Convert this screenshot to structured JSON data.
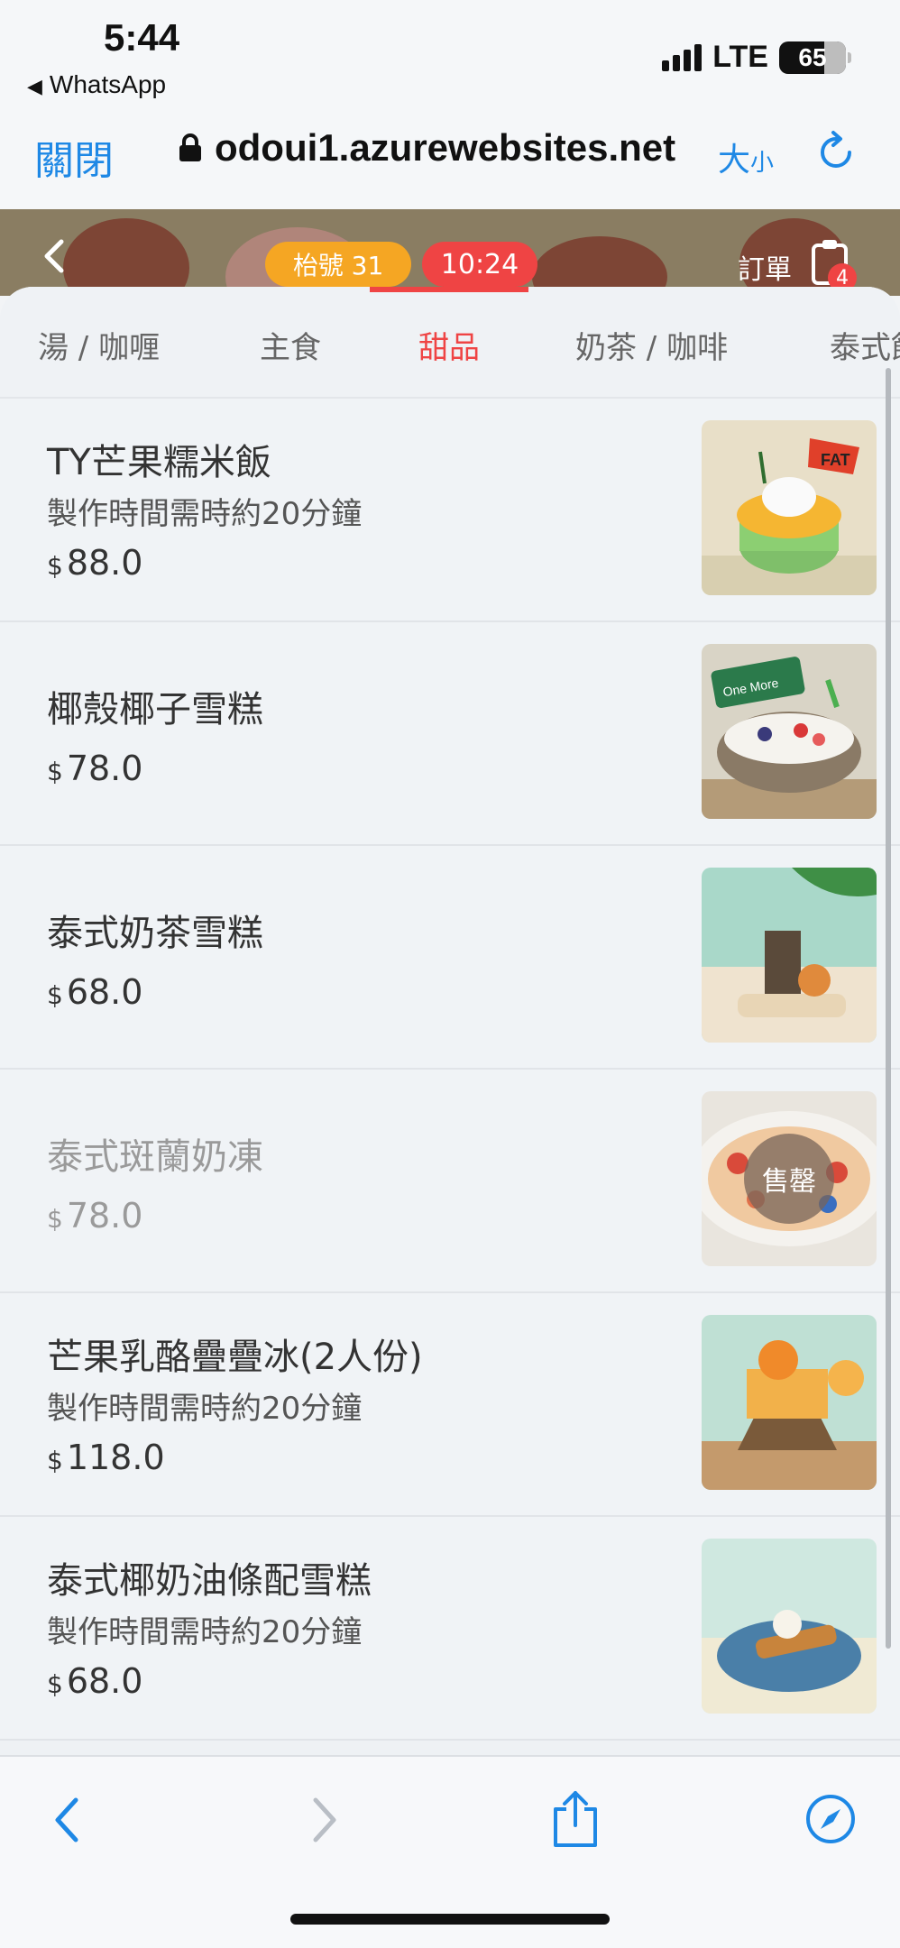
{
  "status_bar": {
    "time": "5:44",
    "back_app": "WhatsApp",
    "network": "LTE",
    "battery": "65"
  },
  "browser": {
    "close_label": "關閉",
    "url": "odoui1.azurewebsites.net",
    "size_label_big": "大",
    "size_label_small": "小"
  },
  "header": {
    "table_label": "枱號 31",
    "time": "10:24",
    "order_label": "訂單",
    "order_count": "4"
  },
  "tabs": [
    {
      "label": "湯 / 咖喱",
      "active": false
    },
    {
      "label": "主食",
      "active": false
    },
    {
      "label": "甜品",
      "active": true
    },
    {
      "label": "奶茶 / 咖啡",
      "active": false
    },
    {
      "label": "泰式飲",
      "active": false
    }
  ],
  "items": [
    {
      "name": "TY芒果糯米飯",
      "note": "製作時間需時約20分鐘",
      "currency": "$",
      "price": "88.0",
      "sold_out": false
    },
    {
      "name": "椰殼椰子雪糕",
      "note": "",
      "currency": "$",
      "price": "78.0",
      "sold_out": false
    },
    {
      "name": "泰式奶茶雪糕",
      "note": "",
      "currency": "$",
      "price": "68.0",
      "sold_out": false
    },
    {
      "name": "泰式斑蘭奶凍",
      "note": "",
      "currency": "$",
      "price": "78.0",
      "sold_out": true,
      "sold_out_label": "售罄"
    },
    {
      "name": "芒果乳酪疊疊冰(2人份)",
      "note": "製作時間需時約20分鐘",
      "currency": "$",
      "price": "118.0",
      "sold_out": false
    },
    {
      "name": "泰式椰奶油條配雪糕",
      "note": "製作時間需時約20分鐘",
      "currency": "$",
      "price": "68.0",
      "sold_out": false
    }
  ],
  "thumb_texts": {
    "fat_sign": "FAT",
    "bowl_sign": "One More"
  },
  "colors": {
    "accent_red": "#ef4444",
    "table_orange": "#f5a623",
    "link_blue": "#1e88e5"
  },
  "toolbar_icons": [
    "back-arrow-icon",
    "forward-arrow-icon",
    "share-icon",
    "compass-icon"
  ]
}
